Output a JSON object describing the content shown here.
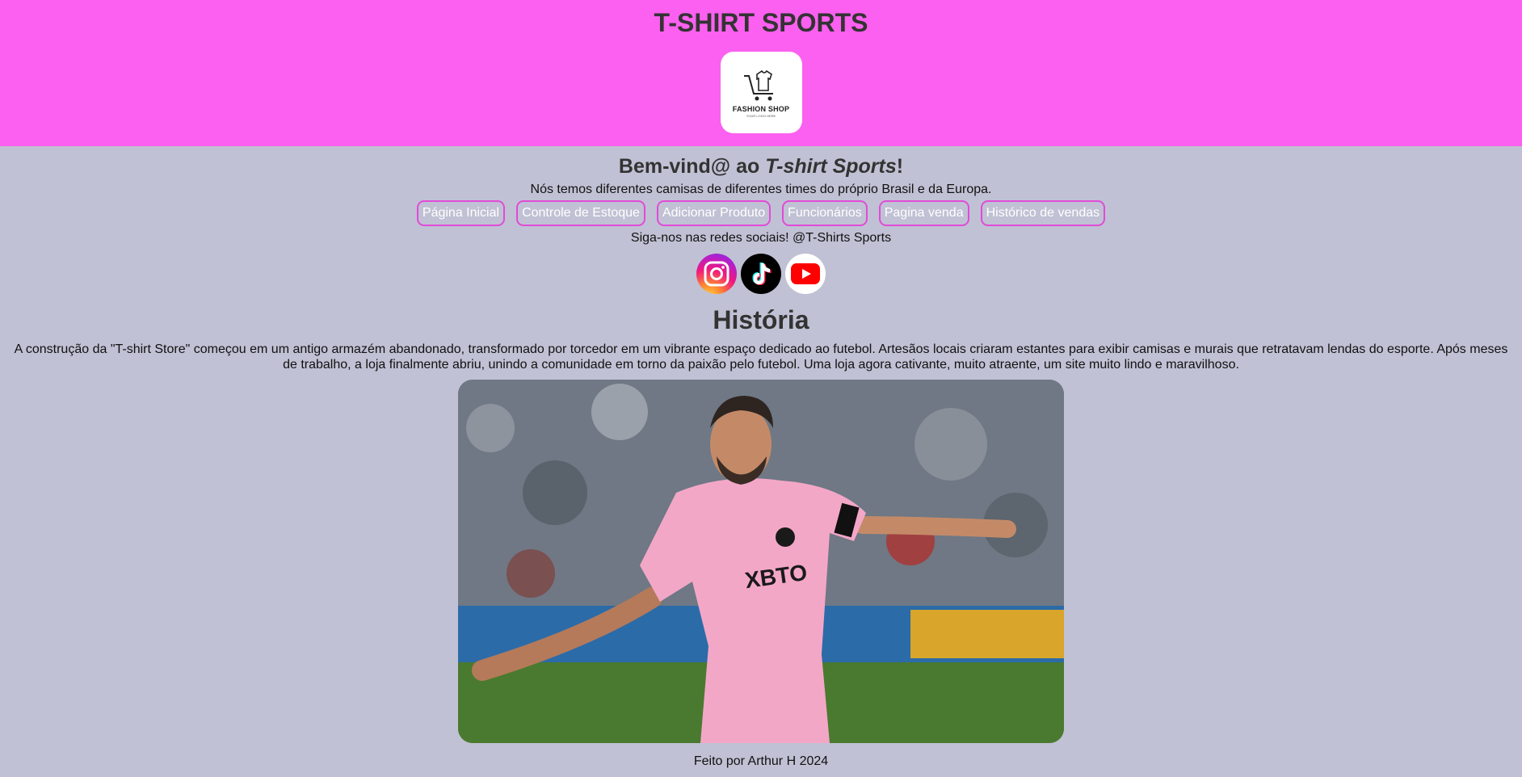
{
  "header": {
    "title": "T-SHIRT SPORTS",
    "logo_text": "FASHION SHOP",
    "logo_subtext": "YOUR LOGO HERE"
  },
  "main": {
    "welcome_prefix": "Bem-vind@ ao ",
    "welcome_brand": "T-shirt Sports",
    "welcome_suffix": "!",
    "subtitle": "Nós temos diferentes camisas de diferentes times do próprio Brasil e da Europa.",
    "nav": [
      {
        "label": "Página Inicial"
      },
      {
        "label": "Controle de Estoque"
      },
      {
        "label": "Adicionar Produto"
      },
      {
        "label": "Funcionários"
      },
      {
        "label": "Pagina venda"
      },
      {
        "label": "Histórico de vendas"
      }
    ],
    "follow_text": "Siga-nos nas redes sociais! @T-Shirts Sports",
    "social": [
      {
        "icon": "instagram-icon"
      },
      {
        "icon": "tiktok-icon"
      },
      {
        "icon": "youtube-icon"
      }
    ],
    "history_title": "História",
    "history_text": "A construção da \"T-shirt Store\" começou em um antigo armazém abandonado, transformado por torcedor em um vibrante espaço dedicado ao futebol. Artesãos locais criaram estantes para exibir camisas e murais que retratavam lendas do esporte. Após meses de trabalho, a loja finalmente abriu, unindo a comunidade em torno da paixão pelo futebol. Uma loja agora cativante, muito atraente, um site muito lindo e maravilhoso.",
    "photo_jersey_text": "XBTO"
  },
  "footer": {
    "text": "Feito por Arthur H 2024"
  },
  "colors": {
    "header_bg": "#fb60f0",
    "page_bg": "#c0c1d4",
    "nav_border": "#e14bd8",
    "heading": "#333333"
  }
}
